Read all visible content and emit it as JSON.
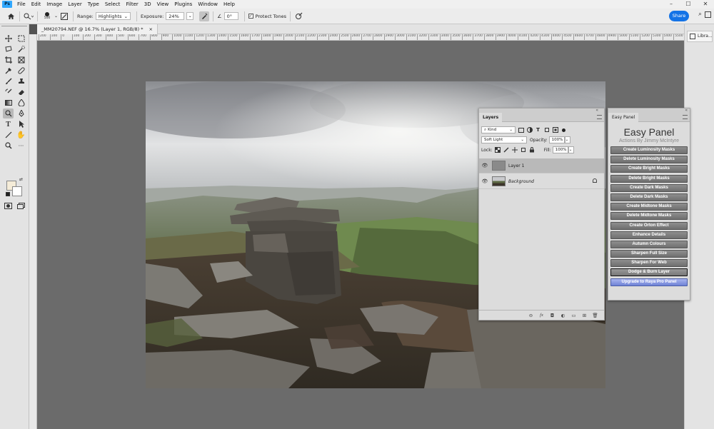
{
  "app": {
    "logo": "Ps"
  },
  "menu": [
    "File",
    "Edit",
    "Image",
    "Layer",
    "Type",
    "Select",
    "Filter",
    "3D",
    "View",
    "Plugins",
    "Window",
    "Help"
  ],
  "window_controls": [
    "–",
    "☐",
    "✕"
  ],
  "options": {
    "brush_size": "500",
    "range_label": "Range:",
    "range_value": "Highlights",
    "exposure_label": "Exposure:",
    "exposure_value": "24%",
    "angle_value": "0°",
    "protect_tones": "Protect Tones",
    "share": "Share"
  },
  "document": {
    "tab_title": "_MM20794.NEF @ 16.7% (Layer 1, RGB/8) *",
    "close": "×"
  },
  "ruler_ticks": [
    "200",
    "100",
    "0",
    "100",
    "200",
    "300",
    "400",
    "500",
    "600",
    "700",
    "800",
    "900",
    "1000",
    "1100",
    "1200",
    "1300",
    "1400",
    "1500",
    "1600",
    "1700",
    "1800",
    "1900",
    "2000",
    "2100",
    "2200",
    "2300",
    "2400",
    "2500",
    "2600",
    "2700",
    "2800",
    "2900",
    "3000",
    "3100",
    "3200",
    "3300",
    "3400",
    "3500",
    "3600",
    "3700",
    "3800",
    "3900",
    "4000",
    "4100",
    "4200",
    "4300",
    "4400",
    "4500",
    "4600",
    "4700",
    "4800",
    "4900",
    "5000",
    "5100",
    "5200",
    "5300",
    "5400",
    "5500",
    "6000"
  ],
  "right_strip": {
    "libraries": "Libra..."
  },
  "layers_panel": {
    "tab": "Layers",
    "kind": "Kind",
    "blend_mode": "Soft Light",
    "opacity_label": "Opacity:",
    "opacity_value": "100%",
    "lock_label": "Lock:",
    "fill_label": "Fill:",
    "fill_value": "100%",
    "layers": [
      {
        "name": "Layer 1",
        "selected": true
      },
      {
        "name": "Background",
        "selected": false
      }
    ]
  },
  "easy_panel": {
    "tab": "Easy Panel",
    "title": "Easy Panel",
    "subtitle": "Actions By Jimmy McIntyre",
    "buttons": [
      "Create Luminosity Masks",
      "Delete Luminosity Masks",
      "Create Bright Masks",
      "Delete Bright Masks",
      "Create Dark Masks",
      "Delete Dark Masks",
      "Create Midtone Masks",
      "Delete Midtone Masks",
      "Create Orton Effect",
      "Enhance Details",
      "Autumn Colours",
      "Sharpen Full Size",
      "Sharpen For Web",
      "Dodge & Burn Layer",
      "Upgrade to Raya Pro Panel"
    ]
  },
  "colors": {
    "accent": "#1473e6",
    "upgrade": "#7b8fdd"
  }
}
